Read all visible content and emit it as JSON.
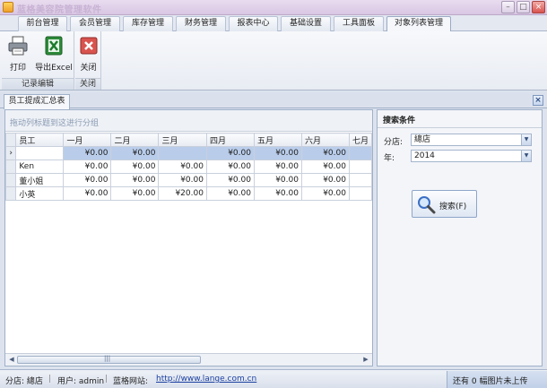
{
  "window": {
    "title": "蓝格美容院管理软件"
  },
  "ribbon_tabs": [
    "前台管理",
    "会员管理",
    "库存管理",
    "财务管理",
    "报表中心",
    "基础设置",
    "工具面板",
    "对象列表管理"
  ],
  "ribbon": {
    "print_label": "打印",
    "export_label": "导出Excel",
    "close_label": "关闭",
    "group_records": "记录编辑",
    "group_close": "关闭"
  },
  "doc_tab": {
    "label": "员工提成汇总表"
  },
  "grid": {
    "group_hint": "拖动列标题到这进行分组",
    "columns": [
      "员工",
      "一月",
      "二月",
      "三月",
      "四月",
      "五月",
      "六月",
      "七月"
    ],
    "rows": [
      [
        "",
        "¥0.00",
        "¥0.00",
        "",
        "¥0.00",
        "¥0.00",
        "¥0.00",
        ""
      ],
      [
        "Ken",
        "¥0.00",
        "¥0.00",
        "¥0.00",
        "¥0.00",
        "¥0.00",
        "¥0.00",
        ""
      ],
      [
        "董小姐",
        "¥0.00",
        "¥0.00",
        "¥0.00",
        "¥0.00",
        "¥0.00",
        "¥0.00",
        ""
      ],
      [
        "小英",
        "¥0.00",
        "¥0.00",
        "¥20.00",
        "¥0.00",
        "¥0.00",
        "¥0.00",
        ""
      ]
    ],
    "scroll_grip": "|||"
  },
  "search": {
    "title": "搜索条件",
    "store_label": "分店:",
    "store_value": "總店",
    "year_label": "年:",
    "year_value": "2014",
    "button_label": "搜索(F)"
  },
  "status": {
    "store": "分店: 總店",
    "user": "用户: admin",
    "site_label": "蓝格网站:",
    "site_url": "http://www.lange.com.cn",
    "upload_notice": "还有 0 幅图片未上传"
  },
  "colors": {
    "accent": "#3a6fc4",
    "selected_row": "#b9cdeb",
    "close_red": "#d9534f",
    "excel_green": "#2e8b3a"
  },
  "icons": [
    "printer-icon",
    "excel-icon",
    "close-icon",
    "magnifier-icon"
  ]
}
